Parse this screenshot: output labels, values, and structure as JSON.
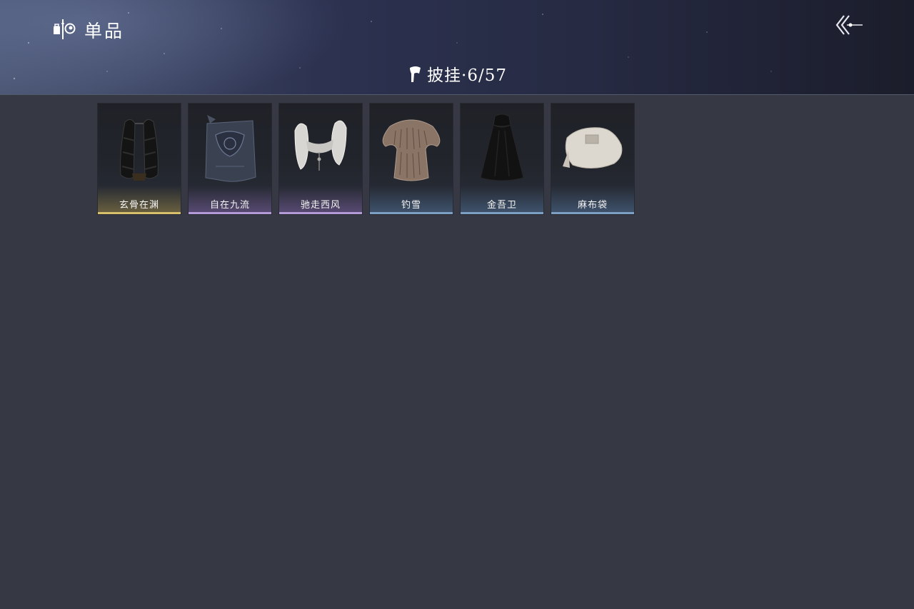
{
  "header": {
    "title": "单品",
    "back_icon": "back-arrow-icon",
    "logo_icon": "wardrobe-logo-icon"
  },
  "category": {
    "icon": "cape-icon",
    "label": "披挂·6/57"
  },
  "items": [
    {
      "name": "玄骨在渊",
      "quality": "gold",
      "icon": "black-feather-cape-icon"
    },
    {
      "name": "自在九流",
      "quality": "purple",
      "icon": "embroidered-cloak-icon"
    },
    {
      "name": "驰走西风",
      "quality": "purple",
      "icon": "white-fur-shawl-icon"
    },
    {
      "name": "钓雪",
      "quality": "blue",
      "icon": "straw-raincoat-icon"
    },
    {
      "name": "金吾卫",
      "quality": "blue",
      "icon": "black-hooded-cloak-icon"
    },
    {
      "name": "麻布袋",
      "quality": "blue",
      "icon": "burlap-sack-icon"
    }
  ],
  "colors": {
    "background": "#363943",
    "gold": "#d8bf6c",
    "purple": "#b59ad8",
    "blue": "#7d9fc4"
  }
}
